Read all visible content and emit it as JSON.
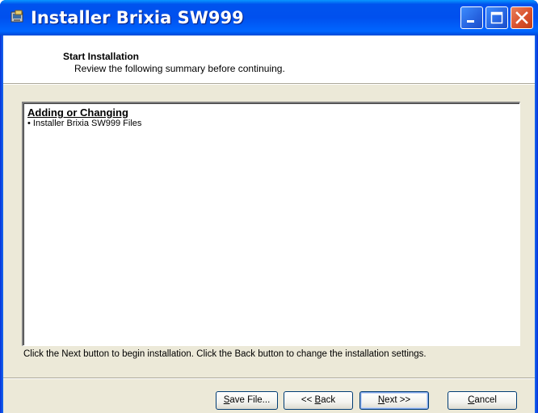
{
  "window": {
    "title": "Installer Brixia SW999"
  },
  "header": {
    "title": "Start Installation",
    "subtitle": "Review the following summary before continuing."
  },
  "summary": {
    "heading": "Adding or Changing",
    "items": [
      "• Installer Brixia SW999 Files"
    ]
  },
  "instruction": "Click the Next button to begin installation.  Click the Back button to change the installation settings.",
  "buttons": {
    "save_accel": "S",
    "save_rest": "ave File...",
    "back_prefix": "<< ",
    "back_accel": "B",
    "back_rest": "ack",
    "next_accel": "N",
    "next_rest": "ext >>",
    "cancel_accel": "C",
    "cancel_rest": "ancel"
  },
  "colors": {
    "titlebar": "#0053ee",
    "client": "#ece9d8",
    "close_button": "#d9512c"
  },
  "icons": [
    "installer-app-icon",
    "minimize-icon",
    "maximize-icon",
    "close-icon"
  ]
}
